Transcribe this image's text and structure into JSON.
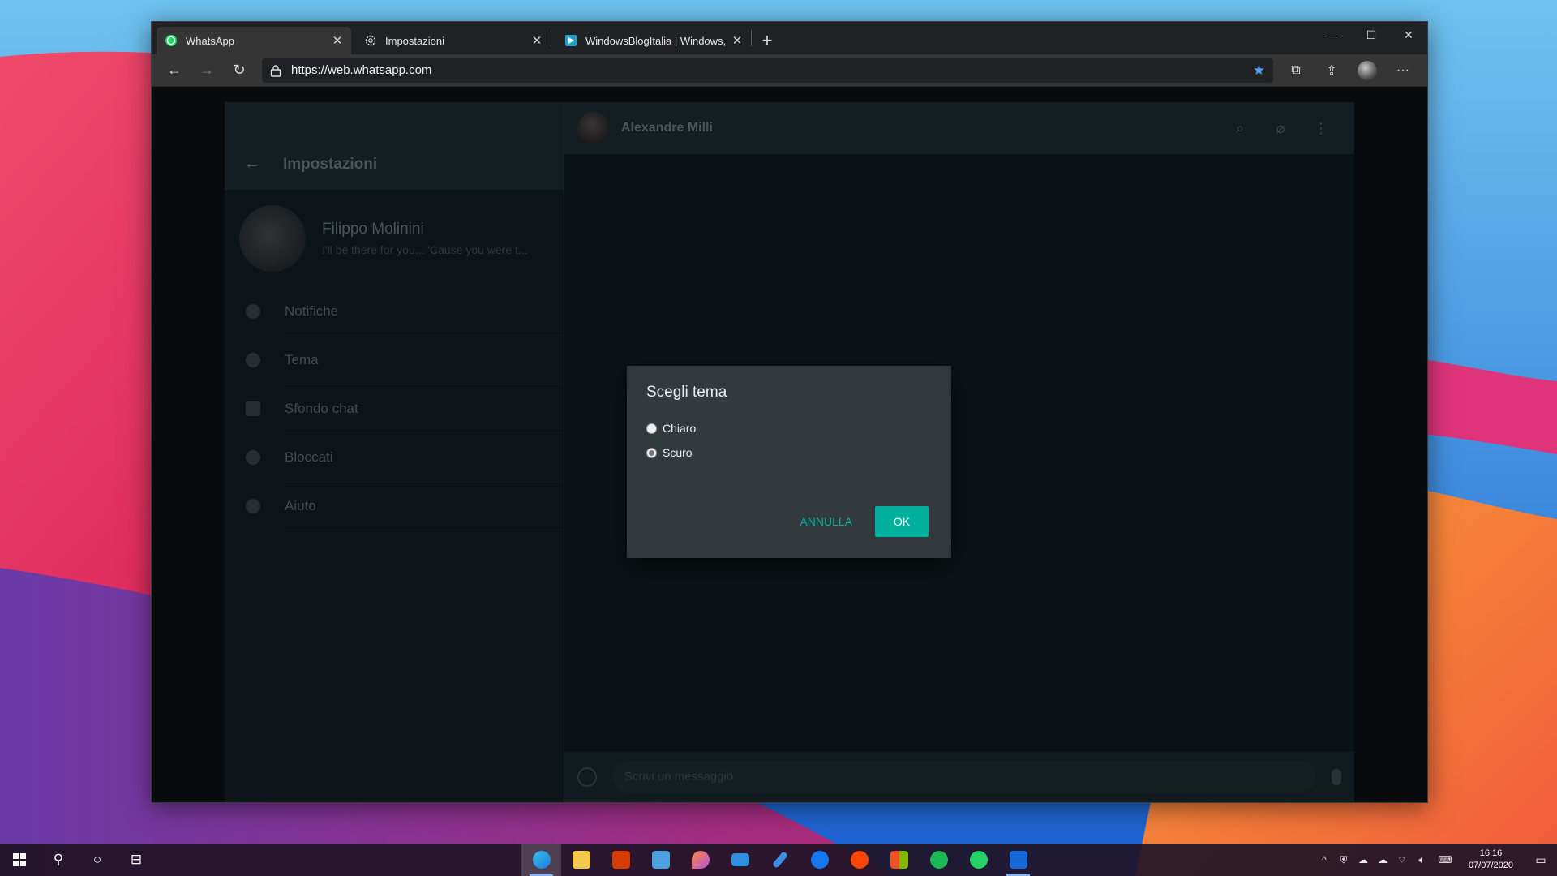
{
  "browser": {
    "tabs": [
      {
        "title": "WhatsApp",
        "icon": "whatsapp-icon",
        "active": true
      },
      {
        "title": "Impostazioni",
        "icon": "gear-icon",
        "active": false
      },
      {
        "title": "WindowsBlogItalia | Windows, Su",
        "icon": "windowsblogitalia-icon",
        "active": false
      }
    ],
    "new_tab_label": "+",
    "url": "https://web.whatsapp.com",
    "window_controls": {
      "minimize": "—",
      "maximize": "☐",
      "close": "✕"
    }
  },
  "whatsapp": {
    "settings_title": "Impostazioni",
    "profile": {
      "name": "Filippo Molinini",
      "status": "I'll be there for you... 'Cause you were t..."
    },
    "settings_items": [
      {
        "label": "Notifiche",
        "icon": "bell-icon"
      },
      {
        "label": "Tema",
        "icon": "theme-icon"
      },
      {
        "label": "Sfondo chat",
        "icon": "wallpaper-icon"
      },
      {
        "label": "Bloccati",
        "icon": "blocked-icon"
      },
      {
        "label": "Aiuto",
        "icon": "help-icon"
      }
    ],
    "chat": {
      "contact_name": "Alexandre Milli",
      "message_placeholder": "Scrivi un messaggio"
    }
  },
  "modal": {
    "title": "Scegli tema",
    "options": [
      {
        "label": "Chiaro",
        "checked": false
      },
      {
        "label": "Scuro",
        "checked": true
      }
    ],
    "cancel_label": "ANNULLA",
    "ok_label": "OK"
  },
  "taskbar": {
    "apps": [
      "edge-icon",
      "file-explorer-icon",
      "office-icon",
      "notepad-icon",
      "paint-icon",
      "mail-icon",
      "pen-icon",
      "facebook-icon",
      "reddit-icon",
      "store-icon",
      "spotify-icon",
      "whatsapp-icon",
      "app-icon"
    ],
    "clock": {
      "time": "16:16",
      "date": "07/07/2020"
    }
  },
  "colors": {
    "accent": "#00af9c",
    "modal_bg": "#333a3e"
  }
}
